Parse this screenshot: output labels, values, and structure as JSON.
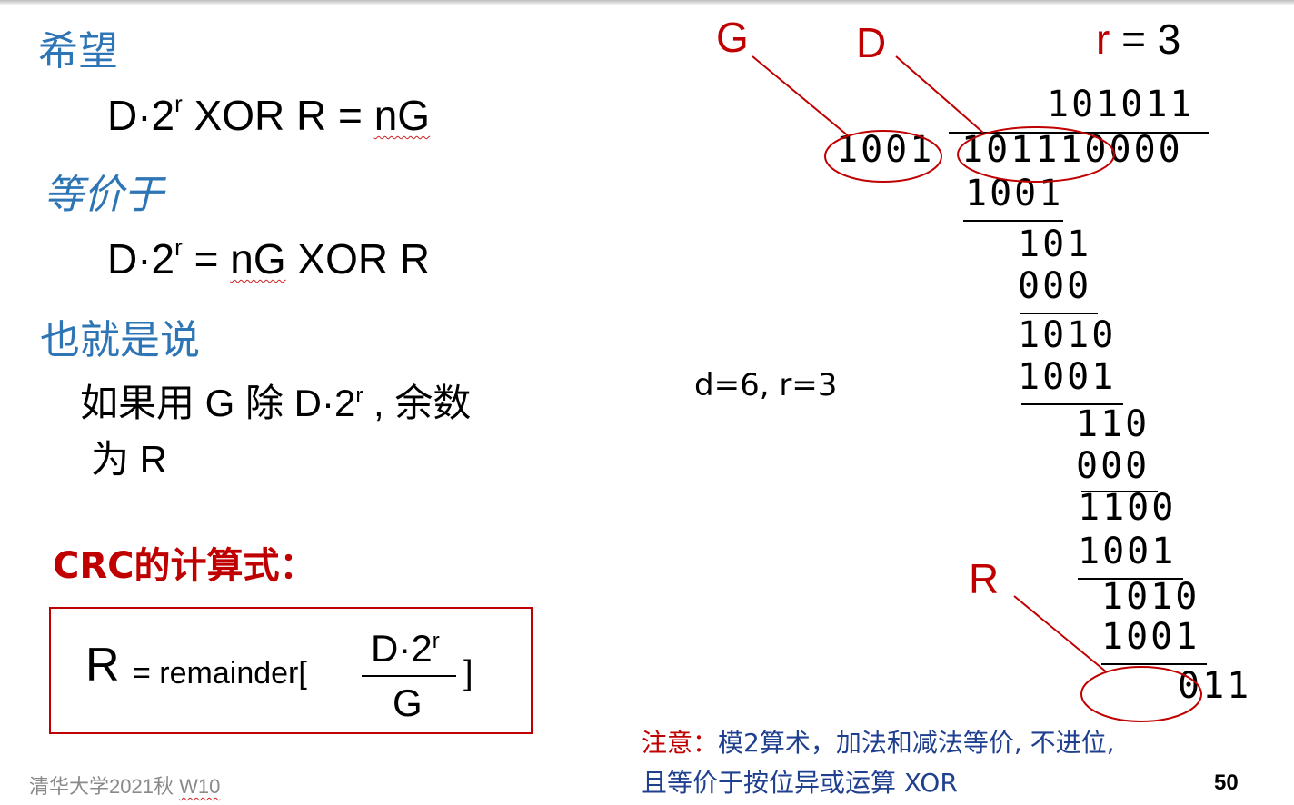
{
  "left": {
    "heading_wish": "希望",
    "eq1_main": "D·2",
    "eq1_sup": "r",
    "eq1_mid": " XOR R = ",
    "eq1_end": "nG",
    "heading_equiv": "等价于",
    "eq2_main": "D·2",
    "eq2_sup": "r",
    "eq2_mid": " = ",
    "eq2_ng": "nG",
    "eq2_end": " XOR R",
    "heading_that_is": "也就是说",
    "text_line1_a": "如果用 G 除 D·2",
    "text_line1_sup": "r",
    "text_line1_b": " , 余数",
    "text_line2": "为 R",
    "crc_heading": "CRC的计算式：",
    "formula": {
      "r": "R",
      "eq": "= remainder[",
      "num_main": "D·2",
      "num_sup": "r",
      "den": "G",
      "close": "]"
    }
  },
  "right": {
    "label_g": "G",
    "label_d": "D",
    "label_r_var": "r",
    "label_r_eq": " = 3",
    "params": "d=6, r=3",
    "label_r_remainder": "R",
    "quotient": "101011",
    "divisor": "1001",
    "dividend": "101110000",
    "steps": [
      "1001",
      "101",
      "000",
      "1010",
      "1001",
      "110",
      "000",
      "1100",
      "1001",
      "1010",
      "1001",
      "011"
    ],
    "note_prefix": "注意：",
    "note_line1": "模2算术，加法和减法等价, 不进位,",
    "note_line2": "且等价于按位异或运算 XOR"
  },
  "footer": {
    "course": "清华大学2021秋 ",
    "week": "W10",
    "page": "50"
  },
  "colors": {
    "heading_blue": "#2E75B6",
    "accent_red": "#C00000",
    "note_blue": "#1F3F8F"
  }
}
